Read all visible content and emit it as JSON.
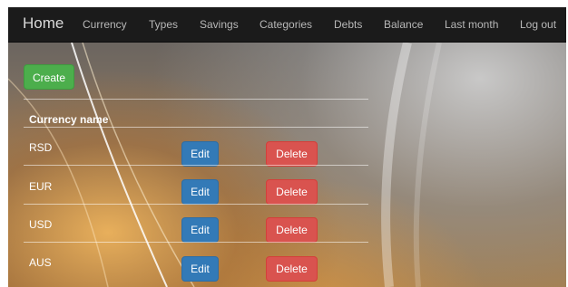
{
  "navbar": {
    "brand": "Home",
    "links": [
      "Currency",
      "Types",
      "Savings",
      "Categories",
      "Debts",
      "Balance",
      "Last month",
      "Log out"
    ]
  },
  "page": {
    "create_label": "Create",
    "column_header": "Currency name",
    "edit_label": "Edit",
    "delete_label": "Delete"
  },
  "currencies": [
    "RSD",
    "EUR",
    "USD",
    "AUS"
  ],
  "colors": {
    "navbar_bg": "#1b1b1b",
    "create_button": "#4cae4c",
    "edit_button": "#337ab7",
    "delete_button": "#d9534f"
  }
}
